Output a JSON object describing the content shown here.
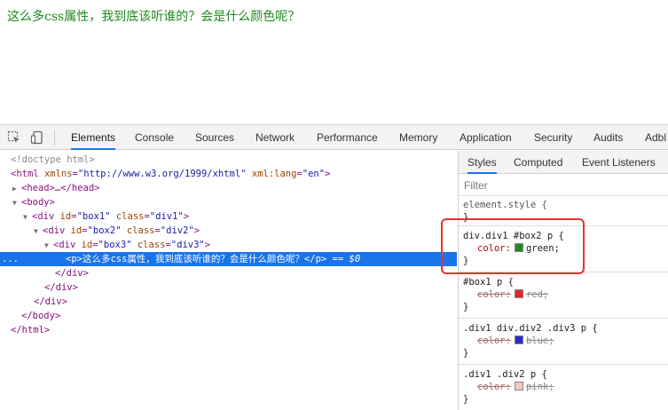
{
  "page": {
    "text": "这么多css属性，我到底该听谁的？会是什么颜色呢？"
  },
  "devtools": {
    "tabs": [
      "Elements",
      "Console",
      "Sources",
      "Network",
      "Performance",
      "Memory",
      "Application",
      "Security",
      "Audits",
      "Adbl"
    ],
    "active_tab": "Elements",
    "icons": [
      "inspect-element-icon",
      "device-toggle-icon"
    ]
  },
  "dom": {
    "doctype": "<!doctype html>",
    "html_tag": "html",
    "html_attrs": [
      {
        "name": "xmlns",
        "value": "\"http://www.w3.org/1999/xhtml\""
      },
      {
        "name": "xml:lang",
        "value": "\"en\""
      }
    ],
    "head_collapsed": "<head>…</head>",
    "body_open": "<body>",
    "div1": {
      "id": "\"box1\"",
      "class": "\"div1\""
    },
    "div2": {
      "id": "\"box2\"",
      "class": "\"div2\""
    },
    "div3": {
      "id": "\"box3\"",
      "class": "\"div3\""
    },
    "p_line": "<p>这么多css属性，我到底该听谁的？会是什么颜色呢？</p>",
    "p_selected_marker": "== $0",
    "selected_ellipsis": "...",
    "close_div": "</div>",
    "close_body": "</body>",
    "close_html": "</html>"
  },
  "styles": {
    "tabs": [
      "Styles",
      "Computed",
      "Event Listeners"
    ],
    "active_tab": "Styles",
    "filter_placeholder": "Filter",
    "rules": [
      {
        "selector": "element.style {",
        "props": [],
        "close": "}"
      },
      {
        "selector": "div.div1 #box2 p {",
        "props": [
          {
            "name": "color:",
            "value": "green;",
            "swatch": "#1f8a1f",
            "strike": false
          }
        ],
        "close": "}"
      },
      {
        "selector": "#box1 p {",
        "props": [
          {
            "name": "color:",
            "value": "red;",
            "swatch": "#e8212a",
            "strike": true
          }
        ],
        "close": "}"
      },
      {
        "selector": ".div1 div.div2 .div3 p {",
        "props": [
          {
            "name": "color:",
            "value": "blue;",
            "swatch": "#2a2acc",
            "strike": true
          }
        ],
        "close": "}"
      },
      {
        "selector": ".div1 .div2 p {",
        "props": [
          {
            "name": "color:",
            "value": "pink;",
            "swatch": "#f6c6c0",
            "strike": true
          }
        ],
        "close": "}"
      }
    ]
  },
  "colors": {
    "accent": "#1a73e8",
    "highlight": "#e8322e",
    "page_text": "#1f8a1f"
  }
}
